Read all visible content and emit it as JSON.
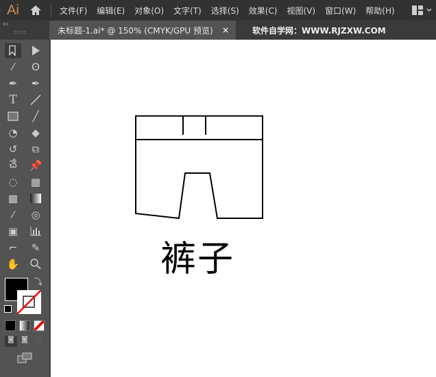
{
  "app": {
    "logo": "Ai"
  },
  "menu": [
    "文件(F)",
    "编辑(E)",
    "对象(O)",
    "文字(T)",
    "选择(S)",
    "效果(C)",
    "视图(V)",
    "窗口(W)",
    "帮助(H)"
  ],
  "tabs": {
    "doc_title": "未标题-1.ai* @ 150% (CMYK/GPU 预览)",
    "close": "×",
    "site": "软件自学网：WWW.RJZXW.COM"
  },
  "panel": {
    "collapse": "‹‹"
  },
  "canvas": {
    "text": "裤子"
  },
  "colors": {
    "fill": "#000000",
    "stroke": "none"
  }
}
